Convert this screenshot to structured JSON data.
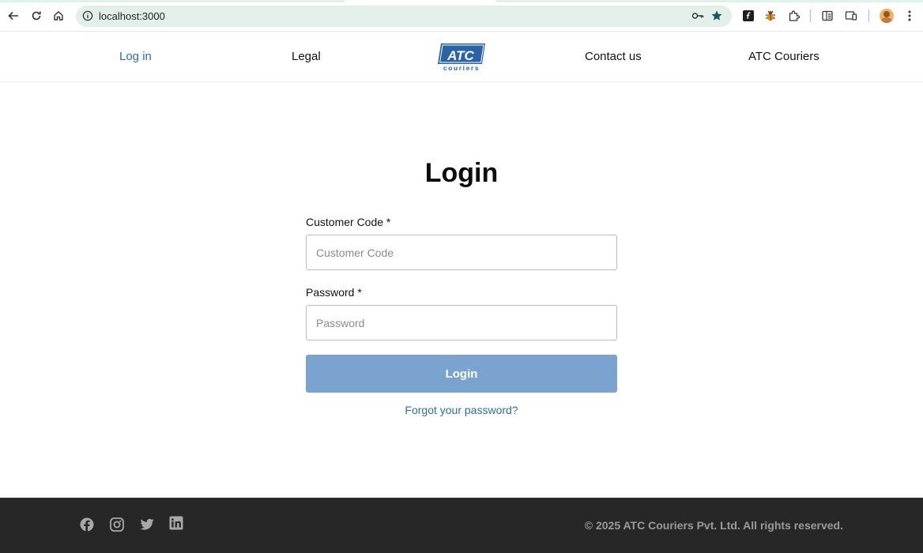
{
  "browser": {
    "url": "localhost:3000",
    "icons": [
      "back-arrow-icon",
      "reload-icon",
      "home-icon",
      "site-info-icon",
      "password-key-icon",
      "bookmark-star-icon",
      "extension-f-icon",
      "bug-extension-icon",
      "extensions-puzzle-icon",
      "reading-list-icon",
      "device-icon",
      "profile-avatar",
      "more-menu-icon"
    ]
  },
  "header": {
    "nav": {
      "login": "Log in",
      "legal": "Legal",
      "contact": "Contact us",
      "company": "ATC Couriers"
    },
    "logo": {
      "main": "ATC",
      "sub": "couriers",
      "color": "#2a63a8"
    }
  },
  "login": {
    "title": "Login",
    "customer_code_label": "Customer Code *",
    "customer_code_placeholder": "Customer Code",
    "password_label": "Password *",
    "password_placeholder": "Password",
    "button_label": "Login",
    "forgot_link": "Forgot your password?"
  },
  "footer": {
    "copyright": "© 2025 ATC Couriers Pvt. Ltd. All rights reserved.",
    "social": [
      "facebook-icon",
      "instagram-icon",
      "twitter-icon",
      "linkedin-icon"
    ]
  },
  "colors": {
    "accent": "#2b6fa8",
    "button": "#7ba3cf",
    "footer_bg": "#272727"
  }
}
